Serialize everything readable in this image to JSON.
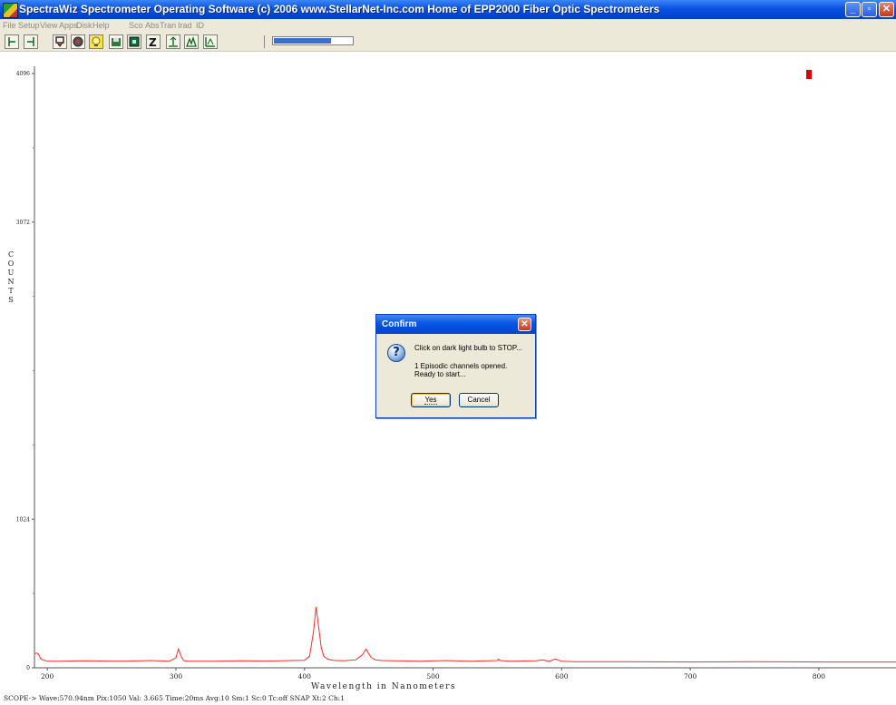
{
  "window": {
    "title": "SpectraWiz Spectrometer Operating Software (c) 2006 www.StellarNet-Inc.com Home of EPP2000 Fiber Optic Spectrometers"
  },
  "menu": {
    "items": [
      "File",
      "Setup",
      "View",
      "Apps",
      "Disk",
      "Help",
      "Sco",
      "Abs",
      "Tran",
      "Irad",
      "ID"
    ]
  },
  "toolbar": {
    "icons": [
      "left-cursor-icon",
      "right-cursor-icon",
      "filter-icon",
      "dark-icon",
      "light-bulb-icon",
      "save-icon",
      "disk-icon",
      "zoom-icon",
      "scale-up-icon",
      "peak-icon",
      "scale-icon"
    ],
    "progress": 0.72
  },
  "chart_data": {
    "type": "line",
    "xlabel": "Wavelength in Nanometers",
    "ylabel": "COUNTS",
    "xlim": [
      190,
      860
    ],
    "ylim": [
      0,
      4096
    ],
    "x_ticks": [
      200,
      300,
      400,
      500,
      600,
      700,
      800
    ],
    "y_ticks": [
      0,
      1024,
      3072,
      4096
    ],
    "grid": false,
    "series": [
      {
        "color": "#ff2a2a",
        "x": [
          190,
          192,
          193,
          195,
          200,
          210,
          230,
          260,
          280,
          295,
          300,
          302,
          304,
          306,
          310,
          330,
          350,
          370,
          390,
          400,
          404,
          407,
          409,
          411,
          413,
          415,
          418,
          422,
          430,
          440,
          445,
          448,
          450,
          452,
          455,
          460,
          470,
          490,
          510,
          530,
          550,
          551,
          552,
          560,
          580,
          585,
          590,
          595,
          600,
          610,
          650,
          700,
          750,
          800,
          860
        ],
        "y": [
          100,
          100,
          95,
          60,
          45,
          45,
          48,
          45,
          50,
          45,
          70,
          130,
          80,
          50,
          45,
          45,
          48,
          46,
          50,
          52,
          80,
          250,
          420,
          280,
          140,
          80,
          60,
          52,
          48,
          55,
          90,
          130,
          95,
          70,
          55,
          50,
          48,
          45,
          50,
          45,
          50,
          60,
          50,
          45,
          48,
          55,
          45,
          60,
          45,
          42,
          42,
          40,
          42,
          40,
          40
        ]
      }
    ],
    "indicator_color": "#e00000"
  },
  "status": {
    "text": "SCOPE-> Wave:570.94nm Pix:1050 Val: 3.665 Time:20ms Avg:10 Sm:1 Sc:0 Tc:off SNAP Xt:2 Ch:1"
  },
  "dialog": {
    "title": "Confirm",
    "line1": "Click on dark light bulb to STOP...",
    "line2": "1 Episodic channels opened.",
    "line3": "Ready to start...",
    "yes_label": "Yes",
    "cancel_label": "Cancel",
    "icon": "question-icon"
  }
}
